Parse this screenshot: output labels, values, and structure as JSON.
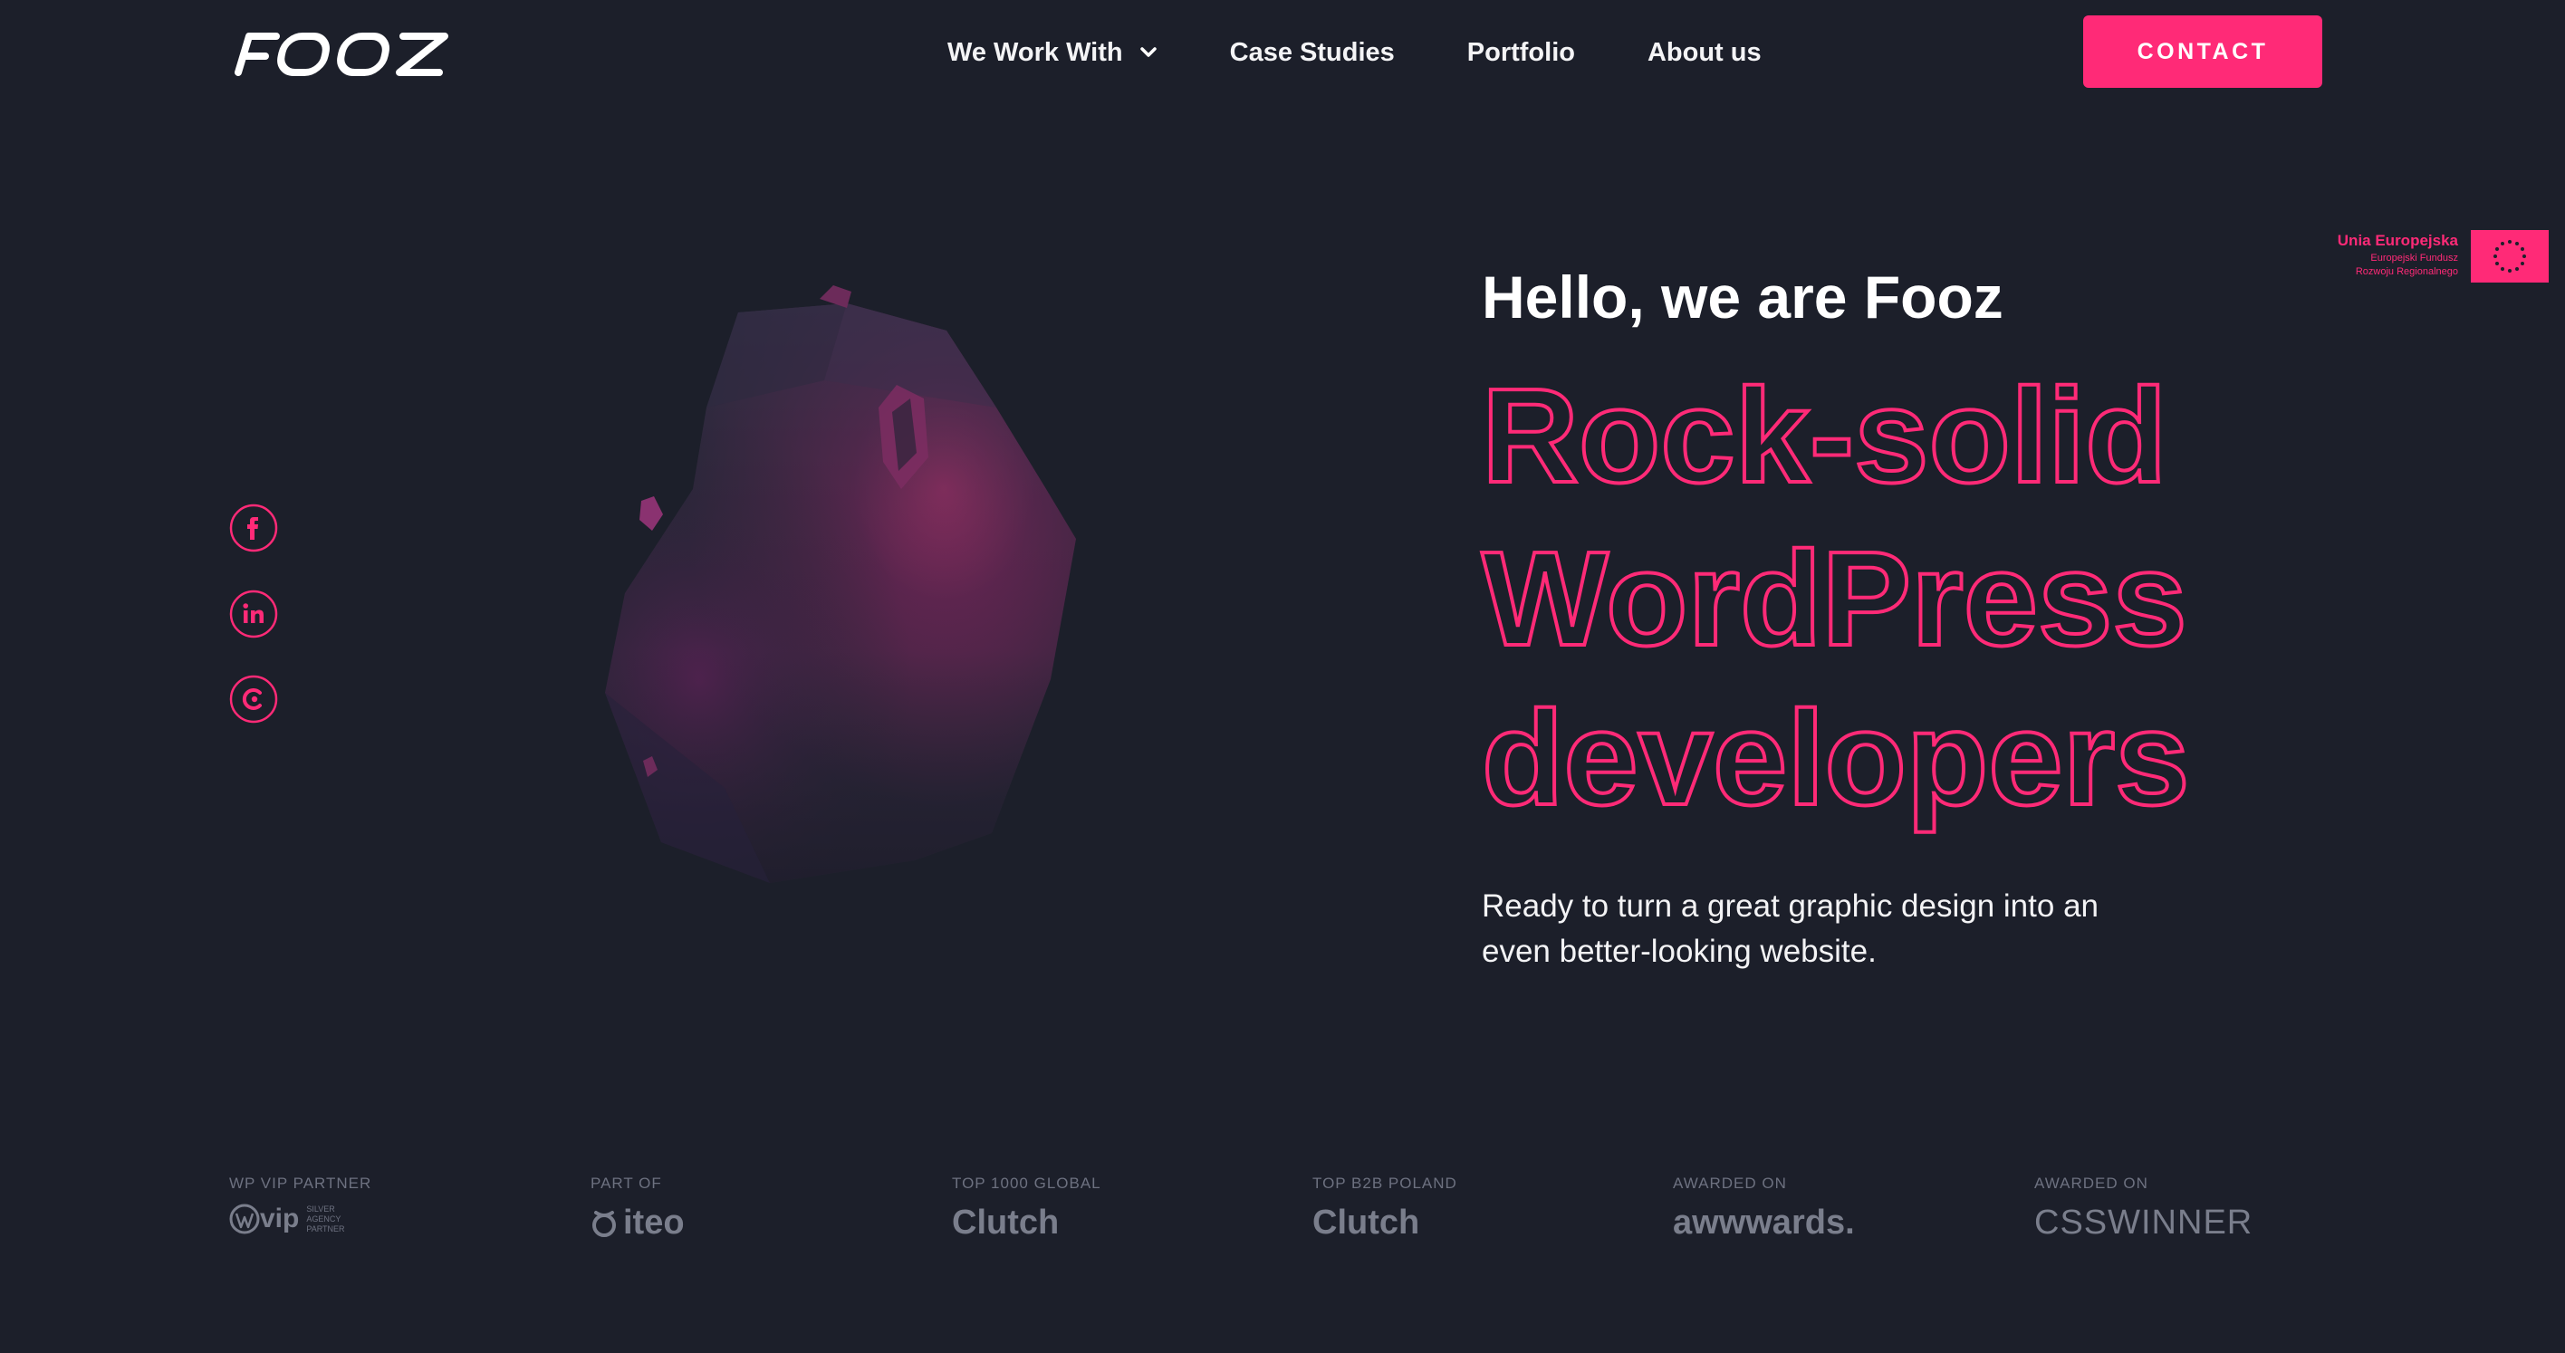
{
  "header": {
    "logo_text": "FOOZ",
    "nav": [
      {
        "label": "We Work With",
        "has_dropdown": true
      },
      {
        "label": "Case Studies"
      },
      {
        "label": "Portfolio"
      },
      {
        "label": "About us"
      }
    ],
    "contact_label": "CONTACT"
  },
  "eu_badge": {
    "title": "Unia Europejska",
    "line1": "Europejski Fundusz",
    "line2": "Rozwoju Regionalnego"
  },
  "social": [
    {
      "name": "facebook",
      "glyph": "f"
    },
    {
      "name": "linkedin",
      "glyph": "in"
    },
    {
      "name": "clutch",
      "glyph": "C"
    }
  ],
  "hero": {
    "greeting": "Hello, we are Fooz",
    "headline": [
      "Rock-solid",
      "WordPress",
      "developers"
    ],
    "subtitle": "Ready to turn a great graphic design into an even better-looking website."
  },
  "partners": [
    {
      "label": "WP VIP PARTNER",
      "logo": "vip",
      "mini": [
        "SILVER",
        "AGENCY",
        "PARTNER"
      ]
    },
    {
      "label": "PART OF",
      "logo": "iteo"
    },
    {
      "label": "TOP 1000 GLOBAL",
      "logo": "Clutch"
    },
    {
      "label": "TOP B2B POLAND",
      "logo": "Clutch"
    },
    {
      "label": "AWARDED ON",
      "logo": "awwwards."
    },
    {
      "label": "AWARDED ON",
      "logo": "CSSWINNER"
    }
  ],
  "colors": {
    "background": "#1c1f2a",
    "accent": "#ff2a77",
    "muted": "#6d7180"
  }
}
